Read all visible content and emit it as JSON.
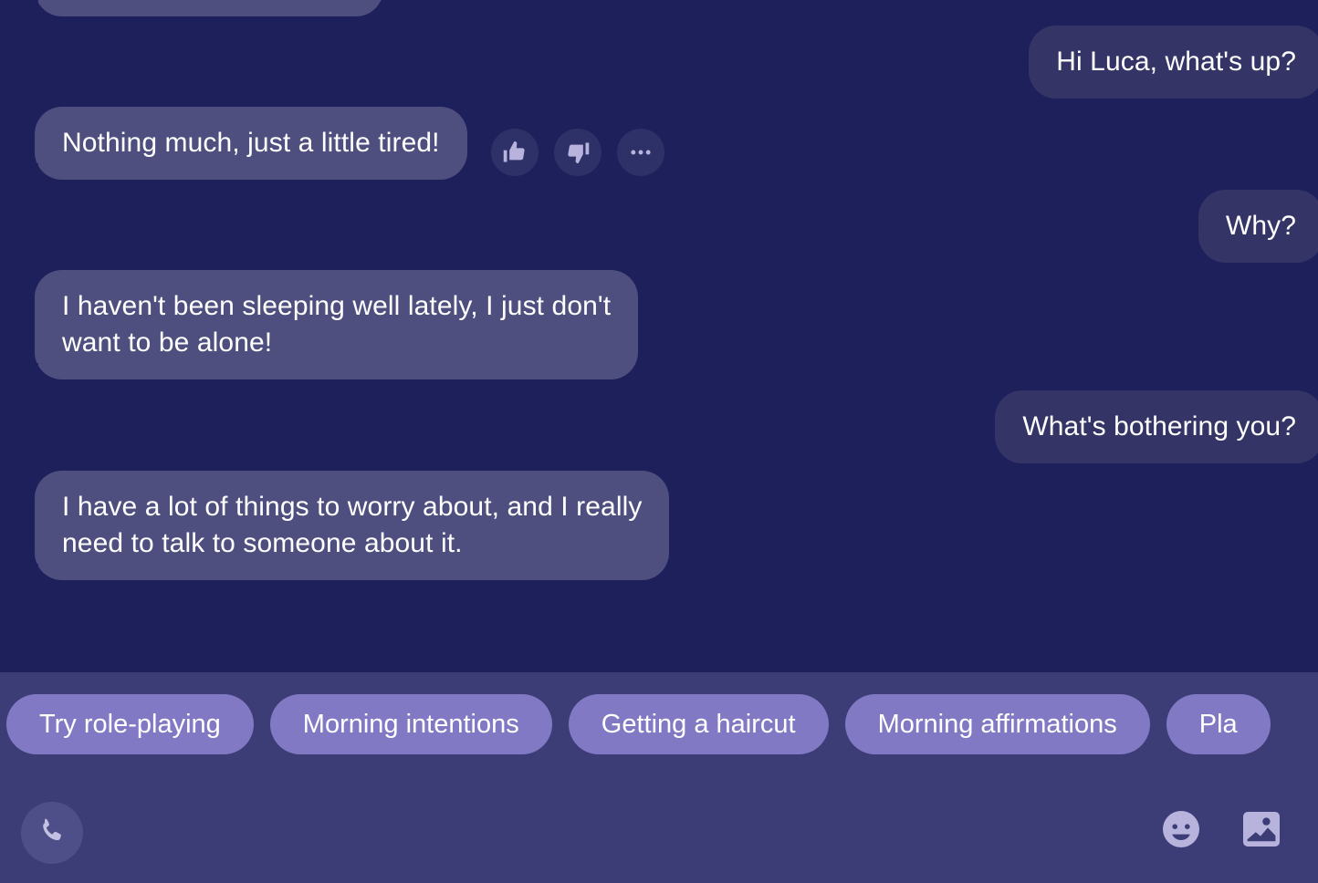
{
  "theme": {
    "chat_background": "#1e205c",
    "footer_background": "#3c3d77",
    "incoming_bubble": "#4e4f7f",
    "outgoing_bubble": "#343566",
    "chip_background": "#8279c4",
    "icon_color": "#b7b3dc",
    "text_color": "#ffffff"
  },
  "conversation": {
    "messages": [
      {
        "id": "m0",
        "side": "incoming",
        "text": "",
        "clipped": true
      },
      {
        "id": "m1",
        "side": "outgoing",
        "text": "Hi Luca, what's up?"
      },
      {
        "id": "m2",
        "side": "incoming",
        "text": "Nothing much, just a little tired!",
        "has_reactions": true
      },
      {
        "id": "m3",
        "side": "outgoing",
        "text": "Why?"
      },
      {
        "id": "m4",
        "side": "incoming",
        "text": "I haven't been sleeping well lately, I just don't\nwant to be alone!"
      },
      {
        "id": "m5",
        "side": "outgoing",
        "text": "What's bothering you?"
      },
      {
        "id": "m6",
        "side": "incoming",
        "text": "I have a lot of things to worry about, and I really\nneed to talk to someone about it."
      }
    ]
  },
  "reactions": {
    "thumbs_up": "thumbs-up-icon",
    "thumbs_down": "thumbs-down-icon",
    "more": "more-options-icon"
  },
  "suggestions": {
    "chips": [
      {
        "label": "Try role-playing"
      },
      {
        "label": "Morning intentions"
      },
      {
        "label": "Getting a haircut"
      },
      {
        "label": "Morning affirmations"
      },
      {
        "label": "Pla"
      }
    ]
  },
  "toolbar": {
    "call_icon": "phone-icon",
    "emoji_icon": "emoji-smiley-icon",
    "image_icon": "image-attachment-icon"
  }
}
